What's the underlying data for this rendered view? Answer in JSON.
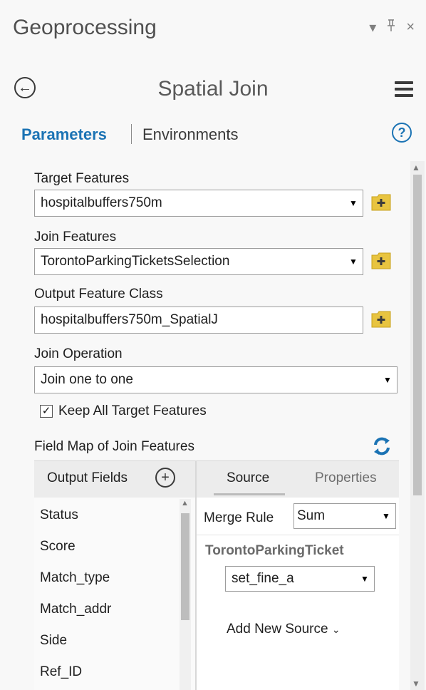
{
  "pane": {
    "title": "Geoprocessing",
    "dropdown_icon": "▾",
    "pin_icon": "ᵖ",
    "close_icon": "×"
  },
  "tool": {
    "title": "Spatial Join"
  },
  "tabs": {
    "parameters": "Parameters",
    "environments": "Environments",
    "help": "?"
  },
  "params": {
    "target_label": "Target Features",
    "target_value": "hospitalbuffers750m",
    "join_label": "Join Features",
    "join_value": "TorontoParkingTicketsSelection",
    "output_label": "Output Feature Class",
    "output_value": "hospitalbuffers750m_SpatialJ",
    "operation_label": "Join Operation",
    "operation_value": "Join one to one",
    "keep_label": "Keep All Target Features",
    "keep_checked": true
  },
  "field_map": {
    "label": "Field Map of Join Features",
    "output_fields_label": "Output Fields",
    "source_tab": "Source",
    "properties_tab": "Properties",
    "fields": [
      "Status",
      "Score",
      "Match_type",
      "Match_addr",
      "Side",
      "Ref_ID"
    ],
    "merge_rule_label": "Merge Rule",
    "merge_rule_value": "Sum",
    "source_layer": "TorontoParkingTicket",
    "source_field": "set_fine_a",
    "add_source_label": "Add New Source"
  },
  "colors": {
    "accent": "#1b73b4",
    "browse_icon": "#e8c440"
  }
}
